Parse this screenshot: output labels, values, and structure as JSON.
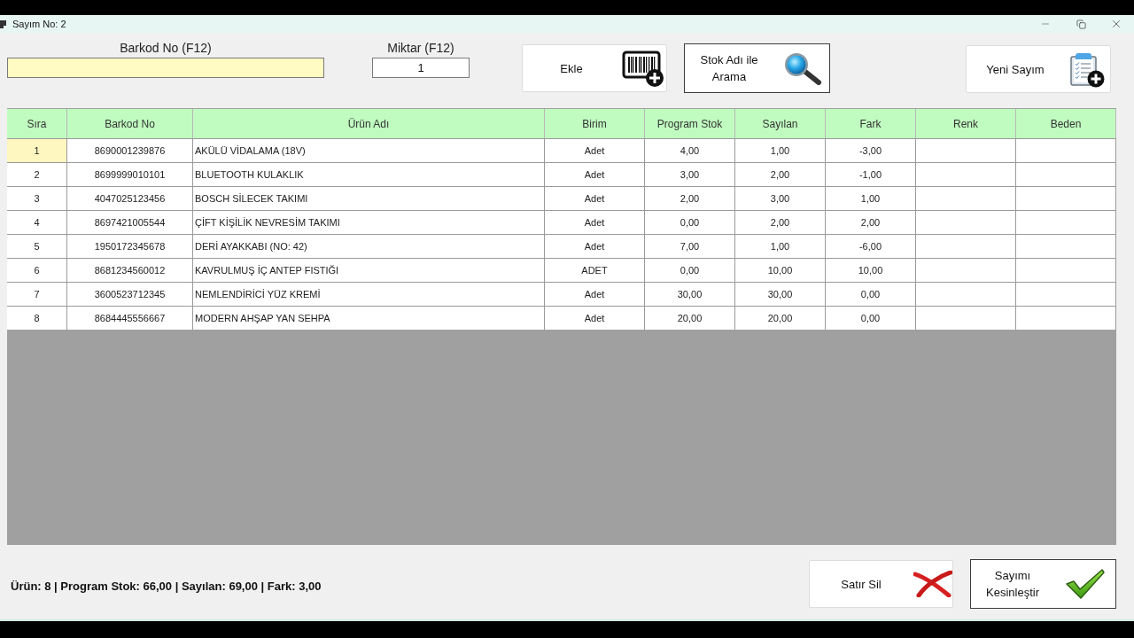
{
  "window": {
    "title": "Sayım No: 2"
  },
  "barcode_field": {
    "label": "Barkod No (F12)"
  },
  "quantity_field": {
    "label": "Miktar (F12)",
    "value": "1"
  },
  "toolbar": [
    {
      "kind": "add",
      "label": "Ekle",
      "outlined": false
    },
    {
      "kind": "search",
      "label": "Stok Adı ile Arama",
      "outlined": true
    },
    {
      "kind": "new",
      "label": "Yeni Sayım",
      "outlined": false
    }
  ],
  "table": {
    "columns": [
      "Sıra",
      "Barkod No",
      "Ürün Adı",
      "Birim",
      "Program Stok",
      "Sayılan",
      "Fark",
      "Renk",
      "Beden"
    ],
    "rows": [
      {
        "selected": true,
        "cells": [
          "1",
          "8690001239876",
          "AKÜLÜ VİDALAMA (18V)",
          "Adet",
          "4,00",
          "1,00",
          "-3,00"
        ]
      },
      {
        "selected": false,
        "cells": [
          "2",
          "8699999010101",
          "BLUETOOTH KULAKLIK",
          "Adet",
          "3,00",
          "2,00",
          "-1,00"
        ]
      },
      {
        "selected": false,
        "cells": [
          "3",
          "4047025123456",
          "BOSCH SİLECEK TAKIMI",
          "Adet",
          "2,00",
          "3,00",
          "1,00"
        ]
      },
      {
        "selected": false,
        "cells": [
          "4",
          "8697421005544",
          "ÇİFT KİŞİLİK NEVRESİM TAKIMI",
          "Adet",
          "0,00",
          "2,00",
          "2,00"
        ]
      },
      {
        "selected": false,
        "cells": [
          "5",
          "1950172345678",
          "DERİ AYAKKABI (NO: 42)",
          "Adet",
          "7,00",
          "1,00",
          "-6,00"
        ]
      },
      {
        "selected": false,
        "cells": [
          "6",
          "8681234560012",
          "KAVRULMUŞ İÇ ANTEP FISTIĞI",
          "ADET",
          "0,00",
          "10,00",
          "10,00"
        ]
      },
      {
        "selected": false,
        "cells": [
          "7",
          "3600523712345",
          "NEMLENDİRİCİ YÜZ KREMİ",
          "Adet",
          "30,00",
          "30,00",
          "0,00"
        ]
      },
      {
        "selected": false,
        "cells": [
          "8",
          "8684445556667",
          "MODERN AHŞAP YAN SEHPA",
          "Adet",
          "20,00",
          "20,00",
          "0,00"
        ]
      }
    ]
  },
  "summary": "Ürün: 8 | Program Stok: 66,00 | Sayılan: 69,00 | Fark: 3,00",
  "footer_buttons": [
    {
      "kind": "delete",
      "label": "Satır Sil",
      "outlined": false
    },
    {
      "kind": "confirm",
      "label": "Sayımı Kesinleştir",
      "outlined": true
    }
  ]
}
